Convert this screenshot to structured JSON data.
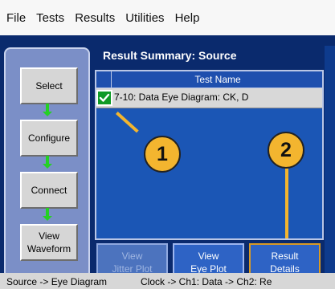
{
  "menu": [
    "File",
    "Tests",
    "Results",
    "Utilities",
    "Help"
  ],
  "left_nav": [
    {
      "label": "Select"
    },
    {
      "label": "Configure"
    },
    {
      "label": "Connect"
    },
    {
      "label": "View\nWaveform"
    }
  ],
  "main": {
    "title": "Result Summary: Source",
    "table": {
      "header": "Test Name",
      "rows": [
        {
          "checked": true,
          "name": "7-10: Data Eye Diagram: CK, D"
        }
      ]
    },
    "buttons": [
      {
        "label": "View\nJitter Plot",
        "enabled": false
      },
      {
        "label": "View\nEye Plot",
        "enabled": true
      },
      {
        "label": "Result\nDetails",
        "enabled": true
      }
    ]
  },
  "callouts": [
    "1",
    "2"
  ],
  "status": {
    "left": "Source -> Eye Diagram",
    "right": "Clock -> Ch1: Data -> Ch2: Re"
  }
}
